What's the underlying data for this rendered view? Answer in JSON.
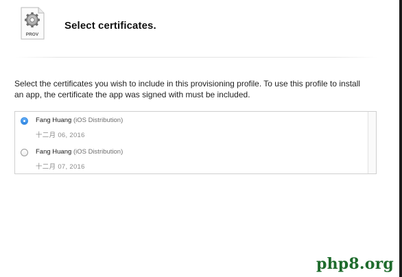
{
  "header": {
    "icon_label": "PROV",
    "title": "Select certificates."
  },
  "instructions": "Select the certificates you wish to include in this provisioning profile. To use this profile to install an app, the certificate the app was signed with must be included.",
  "certificates": [
    {
      "name": "Fang Huang",
      "type": "(iOS Distribution)",
      "date": "十二月 06, 2016",
      "selected": true
    },
    {
      "name": "Fang Huang",
      "type": "(iOS Distribution)",
      "date": "十二月 07, 2016",
      "selected": false
    }
  ],
  "watermark": "php8.org",
  "colors": {
    "radio_selected": "#3d8fe3",
    "watermark": "#1e6b2c"
  },
  "icons": {
    "header": "provisioning-profile-gear-icon"
  }
}
